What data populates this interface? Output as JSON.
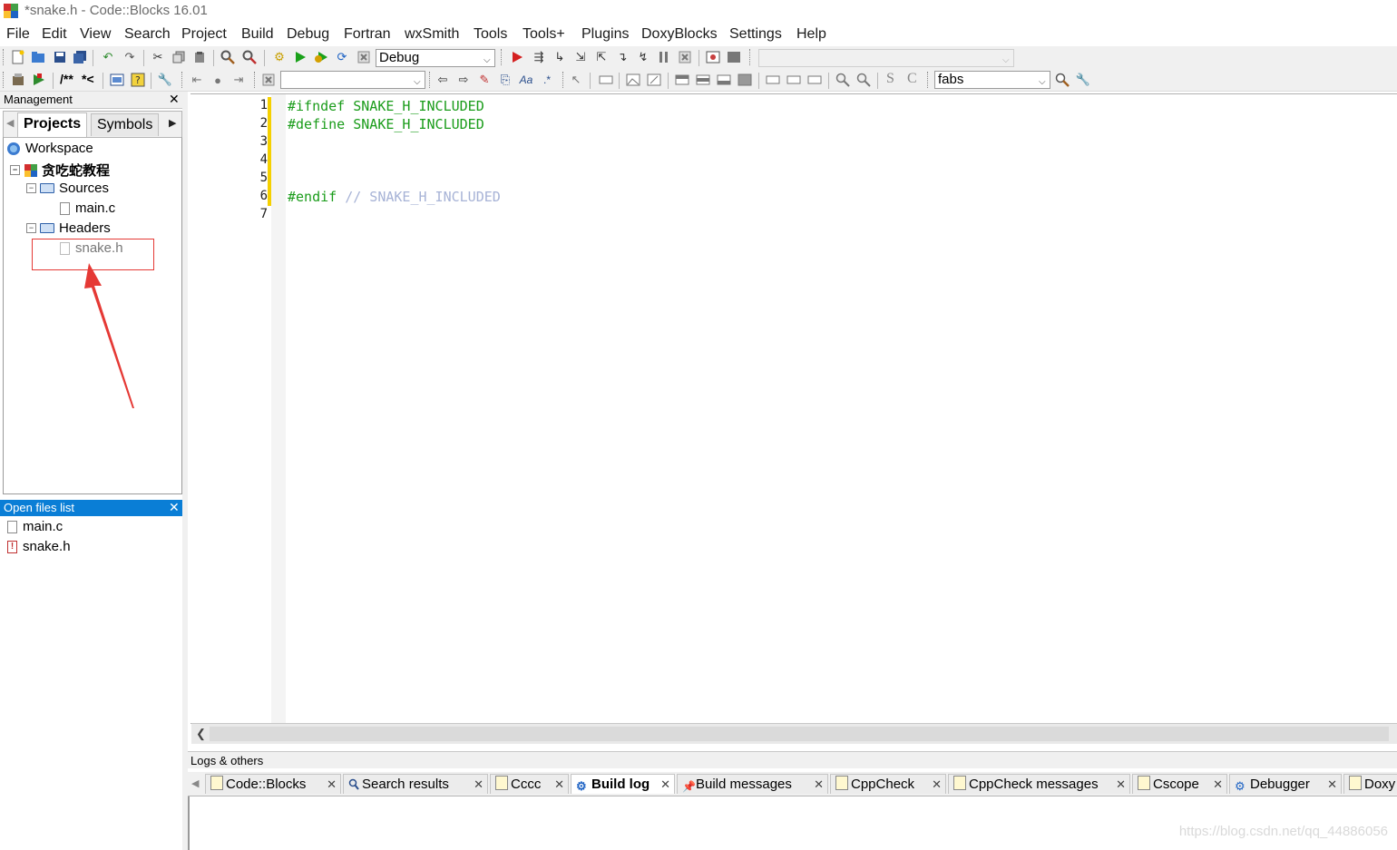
{
  "window": {
    "title": "*snake.h - Code::Blocks 16.01"
  },
  "menu": [
    "File",
    "Edit",
    "View",
    "Search",
    "Project",
    "Build",
    "Debug",
    "Fortran",
    "wxSmith",
    "Tools",
    "Tools+",
    "Plugins",
    "DoxyBlocks",
    "Settings",
    "Help"
  ],
  "toolbar": {
    "build_target": "Debug",
    "doc_comment_1": "/**",
    "doc_comment_2": "*<",
    "symbol_search": "fabs",
    "s_letter": "S",
    "c_letter": "C"
  },
  "management": {
    "title": "Management",
    "tabs": [
      "Projects",
      "Symbols"
    ],
    "active_tab": "Projects",
    "tree": {
      "workspace": "Workspace",
      "project": "贪吃蛇教程",
      "sources_folder": "Sources",
      "sources_file": "main.c",
      "headers_folder": "Headers",
      "headers_file": "snake.h"
    }
  },
  "open_files": {
    "title": "Open files list",
    "files": [
      "main.c",
      "snake.h"
    ]
  },
  "editor": {
    "line_numbers": [
      "1",
      "2",
      "3",
      "4",
      "5",
      "6",
      "7"
    ],
    "lines": {
      "l1": "#ifndef SNAKE_H_INCLUDED",
      "l2": "#define SNAKE_H_INCLUDED",
      "l6_directive": "#endif",
      "l6_comment": "// SNAKE_H_INCLUDED"
    }
  },
  "logs": {
    "title": "Logs & others",
    "tabs": [
      "Code::Blocks",
      "Search results",
      "Cccc",
      "Build log",
      "Build messages",
      "CppCheck",
      "CppCheck messages",
      "Cscope",
      "Debugger",
      "Doxy"
    ],
    "active_tab": "Build log"
  },
  "watermark": "https://blog.csdn.net/qq_44886056",
  "colors": {
    "preprocessor": "#1a9c1a",
    "comment": "#a7b3d6",
    "change_bar": "#f5d000",
    "selection_header": "#0a7ed6",
    "annotation": "#e53935"
  }
}
